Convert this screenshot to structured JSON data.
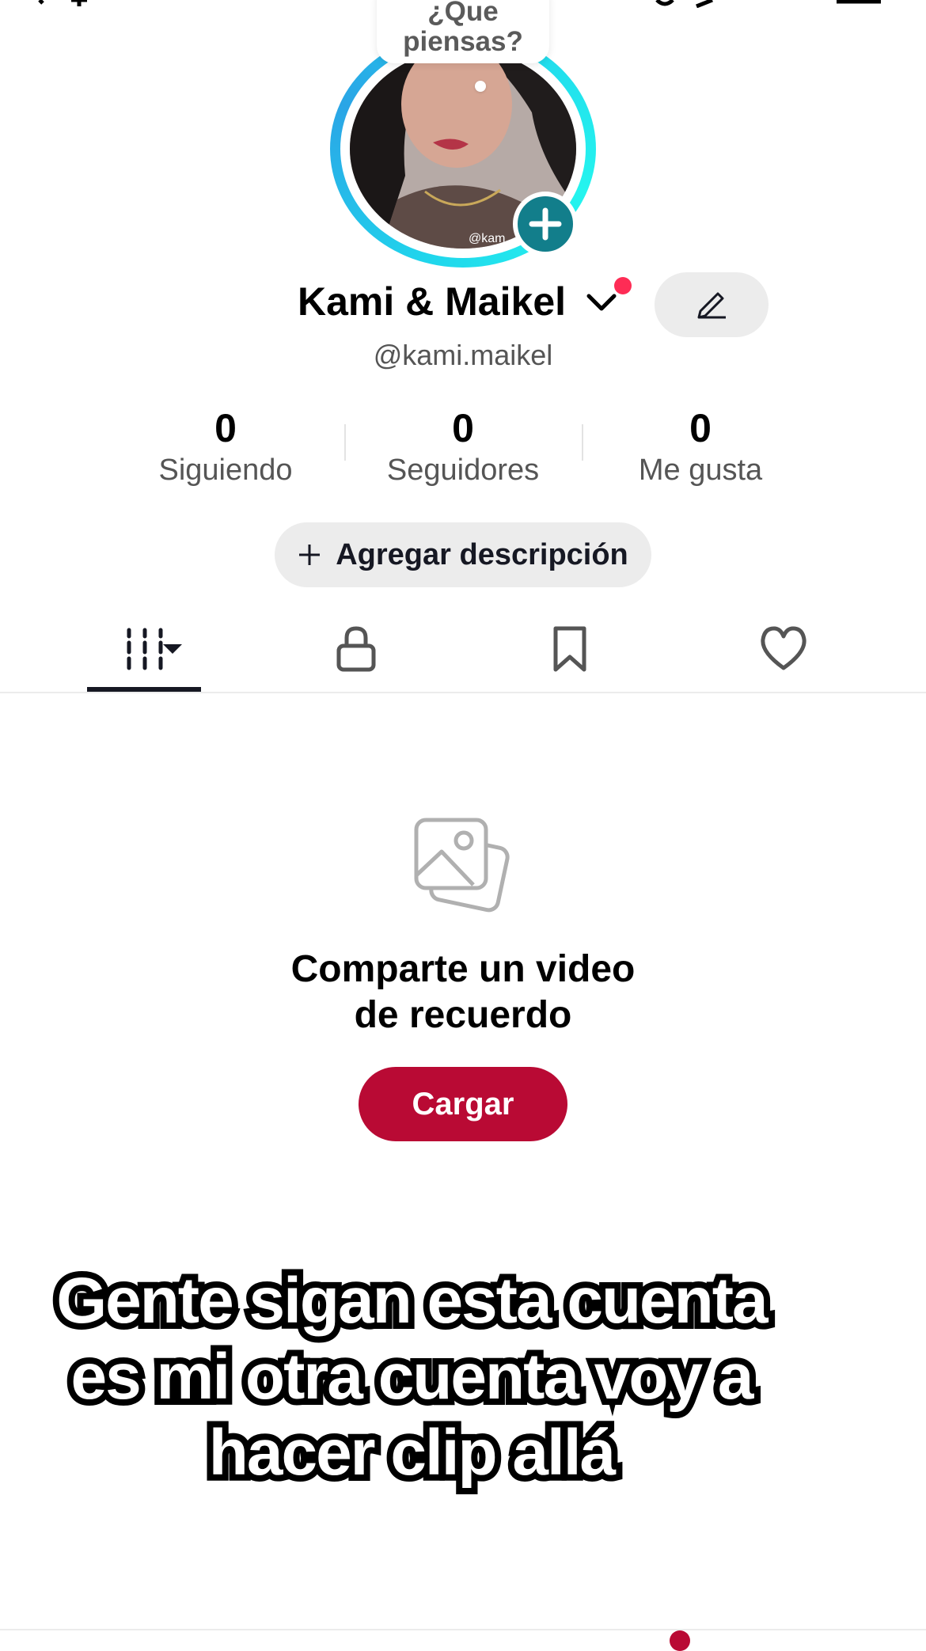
{
  "thought_bubble": {
    "line1": "¿Que",
    "line2": "piensas?"
  },
  "profile": {
    "name": "Kami & Maikel",
    "username": "@kami.maikel",
    "avatar_watermark": "@kam"
  },
  "stats": [
    {
      "value": "0",
      "label": "Siguiendo"
    },
    {
      "value": "0",
      "label": "Seguidores"
    },
    {
      "value": "0",
      "label": "Me gusta"
    }
  ],
  "bio_button": {
    "label": "Agregar descripción"
  },
  "tabs": [
    {
      "icon": "grid-icon"
    },
    {
      "icon": "lock-icon"
    },
    {
      "icon": "bookmark-icon"
    },
    {
      "icon": "heart-icon"
    }
  ],
  "empty_state": {
    "title_line1": "Comparte un video",
    "title_line2": "de recuerdo",
    "button_label": "Cargar"
  },
  "overlay_caption": {
    "line1": "Gente sigan esta cuenta",
    "line2": "es mi otra cuenta voy a",
    "line3": "hacer clip allá"
  },
  "colors": {
    "accent": "#b90a34",
    "notification": "#fe2c55",
    "avatar_ring": "#20d5ec",
    "add_button": "#127e8b"
  }
}
